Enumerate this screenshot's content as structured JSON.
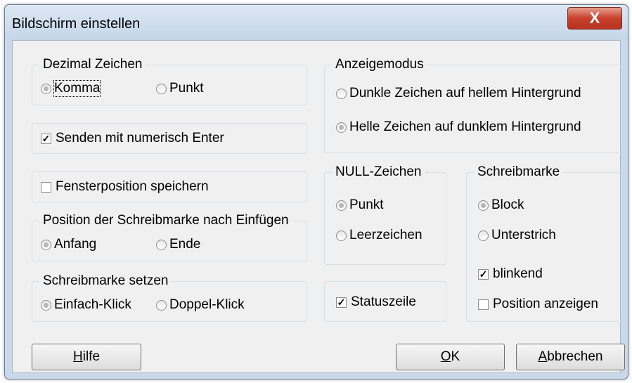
{
  "window": {
    "title": "Bildschirm einstellen",
    "close_glyph": "X"
  },
  "dezimal": {
    "legend": "Dezimal Zeichen",
    "options": [
      "Komma",
      "Punkt"
    ],
    "selected": "Komma"
  },
  "senden": {
    "label": "Senden mit numerisch Enter",
    "checked": true
  },
  "fenster": {
    "label": "Fensterposition speichern",
    "checked": false
  },
  "position_nach": {
    "legend": "Position der Schreibmarke nach Einfügen",
    "options": [
      "Anfang",
      "Ende"
    ],
    "selected": "Anfang"
  },
  "setzen": {
    "legend": "Schreibmarke setzen",
    "options": [
      "Einfach-Klick",
      "Doppel-Klick"
    ],
    "selected": "Einfach-Klick"
  },
  "anzeigemodus": {
    "legend": "Anzeigemodus",
    "options": [
      "Dunkle Zeichen auf hellem Hintergrund",
      "Helle Zeichen auf dunklem Hintergrund"
    ],
    "selected": "Helle Zeichen auf dunklem Hintergrund"
  },
  "null_zeichen": {
    "legend": "NULL-Zeichen",
    "options": [
      "Punkt",
      "Leerzeichen"
    ],
    "selected": "Punkt"
  },
  "statuszeile": {
    "label": "Statuszeile",
    "checked": true
  },
  "schreibmarke": {
    "legend": "Schreibmarke",
    "options": [
      "Block",
      "Unterstrich"
    ],
    "selected": "Block",
    "blinkend_label": "blinkend",
    "blinkend_checked": true,
    "position_label": "Position anzeigen",
    "position_checked": false
  },
  "buttons": {
    "hilfe": {
      "mnemonic": "H",
      "rest": "ilfe"
    },
    "ok": {
      "mnemonic": "O",
      "rest": "K"
    },
    "abbrechen": {
      "mnemonic": "A",
      "rest": "bbrechen"
    }
  }
}
